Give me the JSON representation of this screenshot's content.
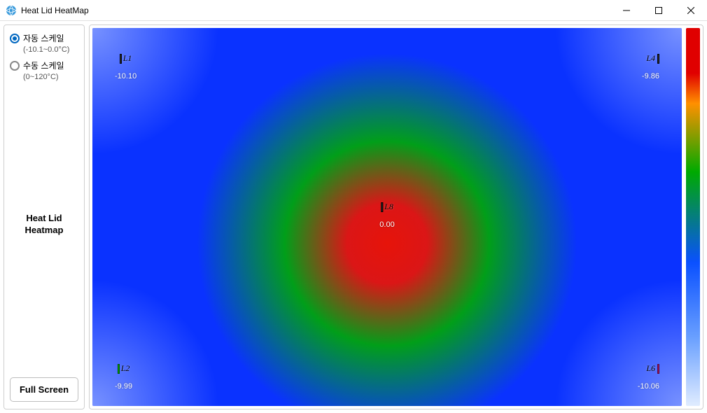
{
  "window": {
    "title": "Heat Lid HeatMap"
  },
  "sidebar": {
    "radio_auto": {
      "label": "자동 스케일",
      "range": "(-10.1~0.0°C)",
      "selected": true
    },
    "radio_manual": {
      "label": "수동 스케일",
      "range": "(0~120°C)",
      "selected": false
    },
    "title_line1": "Heat Lid",
    "title_line2": "Heatmap",
    "full_screen_btn": "Full Screen"
  },
  "chart_data": {
    "type": "heatmap",
    "title": "Heat Lid Heatmap",
    "colormap": "jet-like (red=hot center, blue=cold edges)",
    "value_range_c": [
      -10.1,
      0.0
    ],
    "sensors": [
      {
        "id": "L1",
        "position": "top-left",
        "value": -10.1
      },
      {
        "id": "L4",
        "position": "top-right",
        "value": -9.86
      },
      {
        "id": "L8",
        "position": "center",
        "value": 0.0
      },
      {
        "id": "L2",
        "position": "bottom-left",
        "value": -9.99
      },
      {
        "id": "L6",
        "position": "bottom-right",
        "value": -10.06
      }
    ],
    "sensor_labels": {
      "L1": "L1",
      "L2": "L2",
      "L4": "L4",
      "L6": "L6",
      "L8": "L8"
    },
    "sensor_display": {
      "L1": "-10.10",
      "L4": "-9.86",
      "L8": "0.00",
      "L2": "-9.99",
      "L6": "-10.06"
    }
  }
}
